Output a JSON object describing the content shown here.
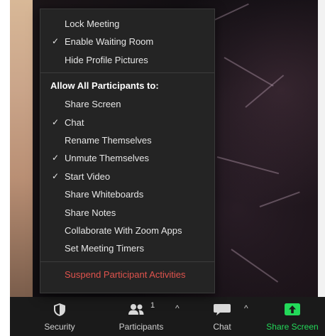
{
  "menu": {
    "top_items": [
      {
        "label": "Lock Meeting",
        "checked": false
      },
      {
        "label": "Enable Waiting Room",
        "checked": true
      },
      {
        "label": "Hide Profile Pictures",
        "checked": false
      }
    ],
    "section_heading": "Allow All Participants to:",
    "participant_items": [
      {
        "label": "Share Screen",
        "checked": false
      },
      {
        "label": "Chat",
        "checked": true
      },
      {
        "label": "Rename Themselves",
        "checked": false
      },
      {
        "label": "Unmute Themselves",
        "checked": true
      },
      {
        "label": "Start Video",
        "checked": true
      },
      {
        "label": "Share Whiteboards",
        "checked": false
      },
      {
        "label": "Share Notes",
        "checked": false
      },
      {
        "label": "Collaborate With Zoom Apps",
        "checked": false
      },
      {
        "label": "Set Meeting Timers",
        "checked": false
      }
    ],
    "danger_item": {
      "label": "Suspend Participant Activities",
      "color": "#e0534d"
    },
    "check_glyph": "✓"
  },
  "toolbar": {
    "security": {
      "label": "Security",
      "icon": "shield-icon"
    },
    "participants": {
      "label": "Participants",
      "icon": "participants-icon",
      "count": "1",
      "caret": "^"
    },
    "chat": {
      "label": "Chat",
      "icon": "chat-bubble-icon",
      "caret": "^"
    },
    "share_screen": {
      "label": "Share Screen",
      "icon": "share-screen-arrow-icon",
      "color": "#23d959"
    }
  }
}
